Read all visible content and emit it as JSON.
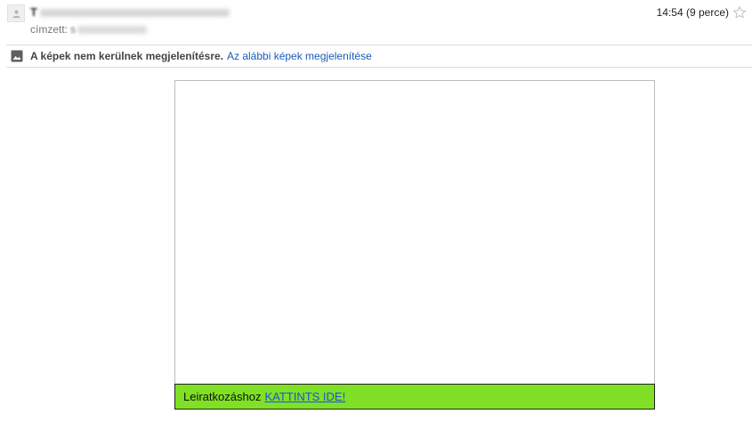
{
  "header": {
    "sender_initial": "T",
    "recipient_label": "címzett:",
    "recipient_initial": "s",
    "time": "14:54 (9 perce)"
  },
  "banner": {
    "notice": "A képek nem kerülnek megjelenítésre.",
    "show_link": "Az alábbi képek megjelenítése"
  },
  "email": {
    "footer_text": "Leiratkozáshoz",
    "footer_link": "KATTINTS IDE!"
  },
  "colors": {
    "footer_bg": "#7fe025",
    "link": "#1a5bb8"
  }
}
